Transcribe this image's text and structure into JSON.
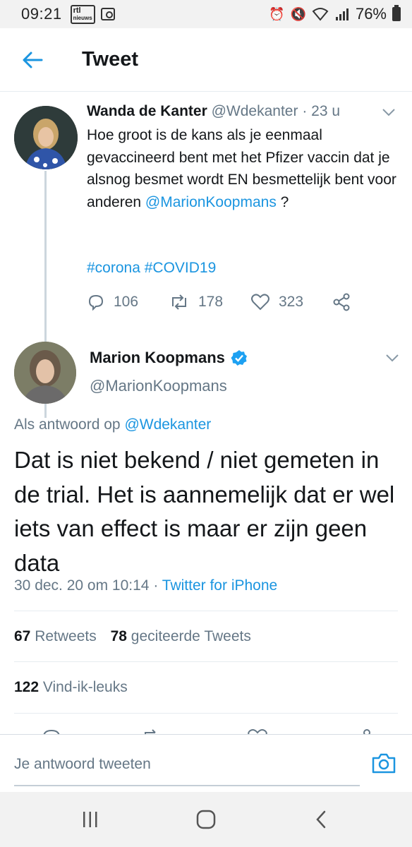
{
  "status_bar": {
    "time": "09:21",
    "rtl_badge": "rtl nieuws",
    "battery": "76%"
  },
  "header": {
    "title": "Tweet"
  },
  "parent_tweet": {
    "name": "Wanda de Kanter",
    "handle": "@Wdekanter",
    "separator": "·",
    "time": "23 u",
    "text": "Hoe groot is de kans als je eenmaal gevaccineerd bent met het Pfizer vaccin dat je alsnog besmet wordt EN besmettelijk bent voor anderen",
    "mention": "@MarionKoopmans",
    "question_mark": " ?",
    "hashtags": "#corona #COVID19",
    "replies": "106",
    "retweets": "178",
    "likes": "323"
  },
  "main_tweet": {
    "name": "Marion Koopmans",
    "handle": "@MarionKoopmans",
    "reply_prefix": "Als antwoord op",
    "reply_to": "@Wdekanter",
    "text": "Dat is niet bekend / niet gemeten in de trial. Het is aannemelijk dat er wel iets van effect is maar er zijn geen data",
    "timestamp": "30 dec. 20 om 10:14",
    "meta_separator": "·",
    "source": "Twitter for iPhone",
    "retweet_count": "67",
    "retweet_label": "Retweets",
    "quote_count": "78",
    "quote_label": "geciteerde Tweets",
    "like_count": "122",
    "like_label": "Vind-ik-leuks"
  },
  "composer": {
    "placeholder": "Je antwoord tweeten"
  },
  "colors": {
    "link": "#1b95e0",
    "muted": "#657786",
    "text": "#14171a",
    "divider": "#e6ecf0"
  },
  "icons": [
    "back-arrow-icon",
    "chevron-down-icon",
    "reply-icon",
    "retweet-icon",
    "like-icon",
    "share-icon",
    "verified-badge-icon",
    "camera-icon",
    "recent-apps-icon",
    "home-icon",
    "back-nav-icon"
  ]
}
